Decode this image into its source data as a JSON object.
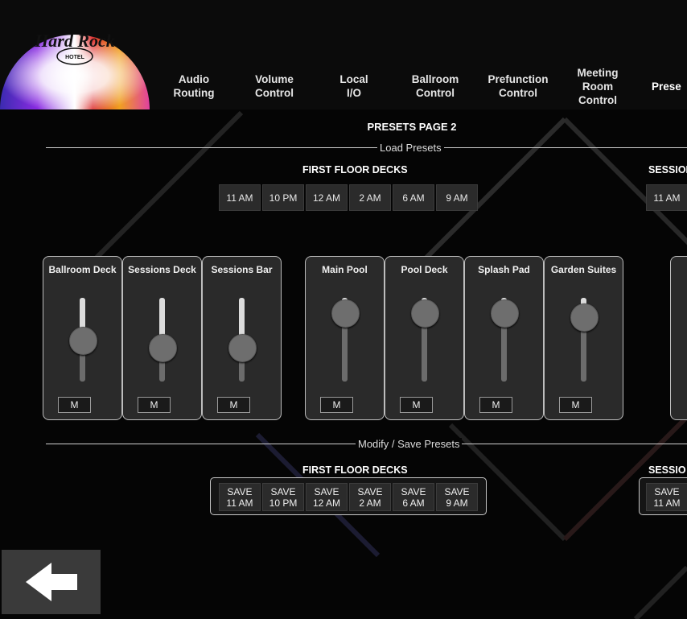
{
  "logo": {
    "brand": "Hard Rock",
    "sub": "HOTEL"
  },
  "nav": [
    {
      "label": "Audio\nRouting"
    },
    {
      "label": "Volume\nControl"
    },
    {
      "label": "Local\nI/O"
    },
    {
      "label": "Ballroom\nControl"
    },
    {
      "label": "Prefunction\nControl"
    },
    {
      "label": "Meeting\nRoom\nControl"
    },
    {
      "label": "Prese"
    }
  ],
  "page_title": "PRESETS PAGE 2",
  "sections": {
    "load": "Load Presets",
    "save": "Modify / Save Presets"
  },
  "groups": {
    "first": {
      "title": "FIRST FLOOR DECKS",
      "presets": [
        "11 AM",
        "10 PM",
        "12 AM",
        "2 AM",
        "6 AM",
        "9 AM"
      ],
      "save": [
        "SAVE\n11 AM",
        "SAVE\n10 PM",
        "SAVE\n12 AM",
        "SAVE\n2 AM",
        "SAVE\n6 AM",
        "SAVE\n9 AM"
      ]
    },
    "sessions": {
      "title_top": "SESSION",
      "title_bottom": "SESSIO",
      "presets": [
        "11 AM"
      ],
      "save": [
        "SAVE\n11 AM"
      ]
    }
  },
  "faders": [
    {
      "name": "Ballroom Deck",
      "level": 0.5,
      "mute": "M"
    },
    {
      "name": "Sessions Deck",
      "level": 0.41,
      "mute": "M"
    },
    {
      "name": "Sessions Bar",
      "level": 0.41,
      "mute": "M"
    },
    {
      "name": "Main Pool",
      "level": 0.82,
      "mute": "M"
    },
    {
      "name": "Pool Deck",
      "level": 0.82,
      "mute": "M"
    },
    {
      "name": "Splash Pad",
      "level": 0.82,
      "mute": "M"
    },
    {
      "name": "Garden Suites",
      "level": 0.77,
      "mute": "M"
    }
  ],
  "icons": {
    "back": "back-arrow-icon"
  }
}
